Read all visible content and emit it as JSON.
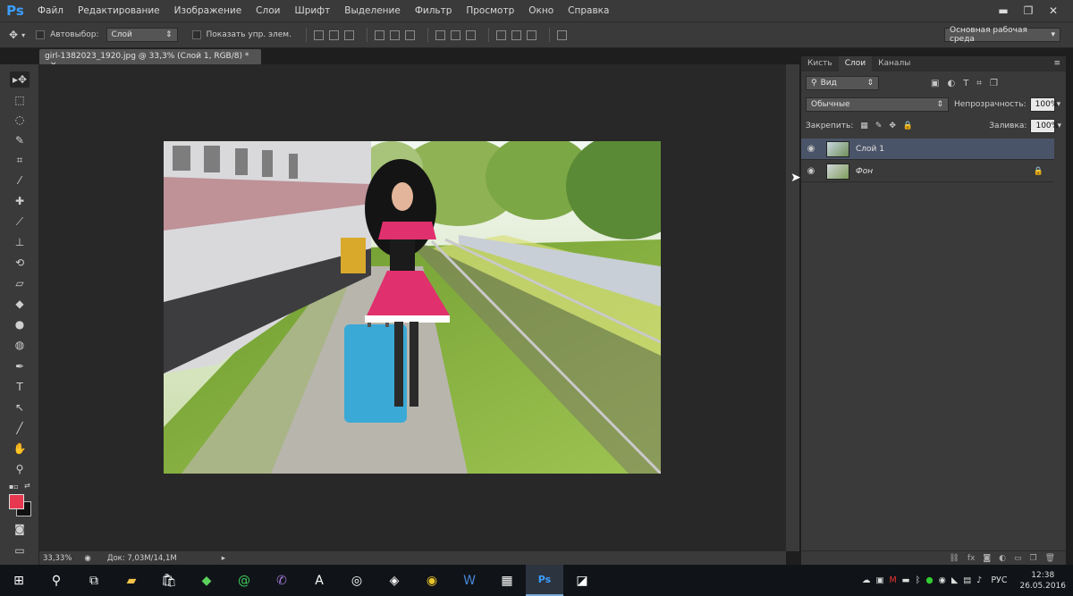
{
  "app": {
    "logo": "Ps"
  },
  "menu": [
    "Файл",
    "Редактирование",
    "Изображение",
    "Слои",
    "Шрифт",
    "Выделение",
    "Фильтр",
    "Просмотр",
    "Окно",
    "Справка"
  ],
  "window_controls": {
    "minimize": "▬",
    "restore": "❐",
    "close": "✕"
  },
  "options": {
    "autoselect_label": "Автовыбор:",
    "autoselect_value": "Слой",
    "show_controls_label": "Показать упр. элем.",
    "workspace": "Основная рабочая среда"
  },
  "document": {
    "tab_title": "girl-1382023_1920.jpg @ 33,3% (Слой 1, RGB/8) *"
  },
  "status": {
    "zoom": "33,33%",
    "doc_info": "Док: 7,03M/14,1M"
  },
  "panel": {
    "tabs": [
      "Кисть",
      "Слои",
      "Каналы"
    ],
    "active_tab": "Слои",
    "filter_kind": "Вид",
    "blend_mode": "Обычные",
    "opacity_label": "Непрозрачность:",
    "opacity_value": "100%",
    "lock_label": "Закрепить:",
    "fill_label": "Заливка:",
    "fill_value": "100%",
    "layers": [
      {
        "name": "Слой 1",
        "selected": true,
        "locked": false
      },
      {
        "name": "Фон",
        "selected": false,
        "locked": true
      }
    ],
    "bottom_icons": [
      "link-icon",
      "fx-icon",
      "mask-icon",
      "adjustment-icon",
      "group-icon",
      "new-layer-icon",
      "trash-icon"
    ]
  },
  "colors": {
    "foreground": "#e8384f",
    "background": "#111111",
    "accent": "#3d9eff"
  },
  "taskbar": {
    "apps": [
      "start-icon",
      "search-icon",
      "task-view-icon",
      "explorer-icon",
      "store-icon",
      "gem-app-icon",
      "at-mail-icon",
      "viber-icon",
      "font-app-icon",
      "app-icon",
      "app-icon-2",
      "chrome-icon",
      "word-icon",
      "calculator-icon",
      "photoshop-icon",
      "app-icon-3"
    ],
    "language": "РУС",
    "time": "12:38",
    "date": "26.05.2016"
  }
}
